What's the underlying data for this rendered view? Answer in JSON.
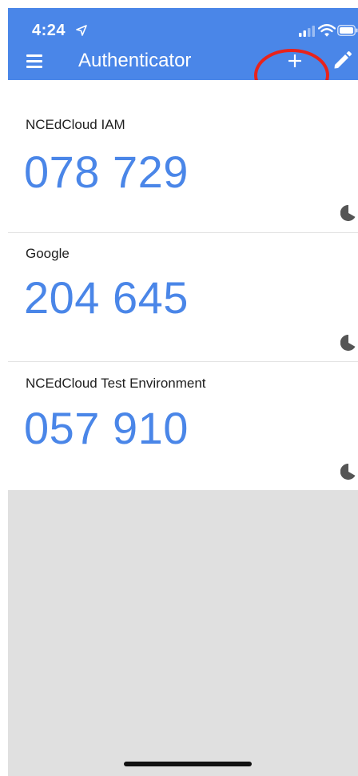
{
  "status_bar": {
    "time": "4:24",
    "location_icon": "location-arrow-icon",
    "icons": [
      "signal-icon",
      "wifi-icon",
      "battery-icon"
    ]
  },
  "app_bar": {
    "title": "Authenticator",
    "menu_icon": "hamburger-menu-icon",
    "add_icon": "plus-icon",
    "edit_icon": "pencil-icon",
    "background": "#4a86e8"
  },
  "annotation": {
    "shape": "red circle around plus button with upward arrow",
    "color": "#e8231c"
  },
  "accounts": [
    {
      "issuer": "NCEdCloud IAM",
      "code": "078 729",
      "timer_icon": "countdown-pie-icon"
    },
    {
      "issuer": "Google",
      "code": "204 645",
      "timer_icon": "countdown-pie-icon"
    },
    {
      "issuer": "NCEdCloud Test Environment",
      "code": "057 910",
      "timer_icon": "countdown-pie-icon"
    }
  ],
  "colors": {
    "code": "#4a86e8",
    "empty_area": "#e0e0e0"
  }
}
